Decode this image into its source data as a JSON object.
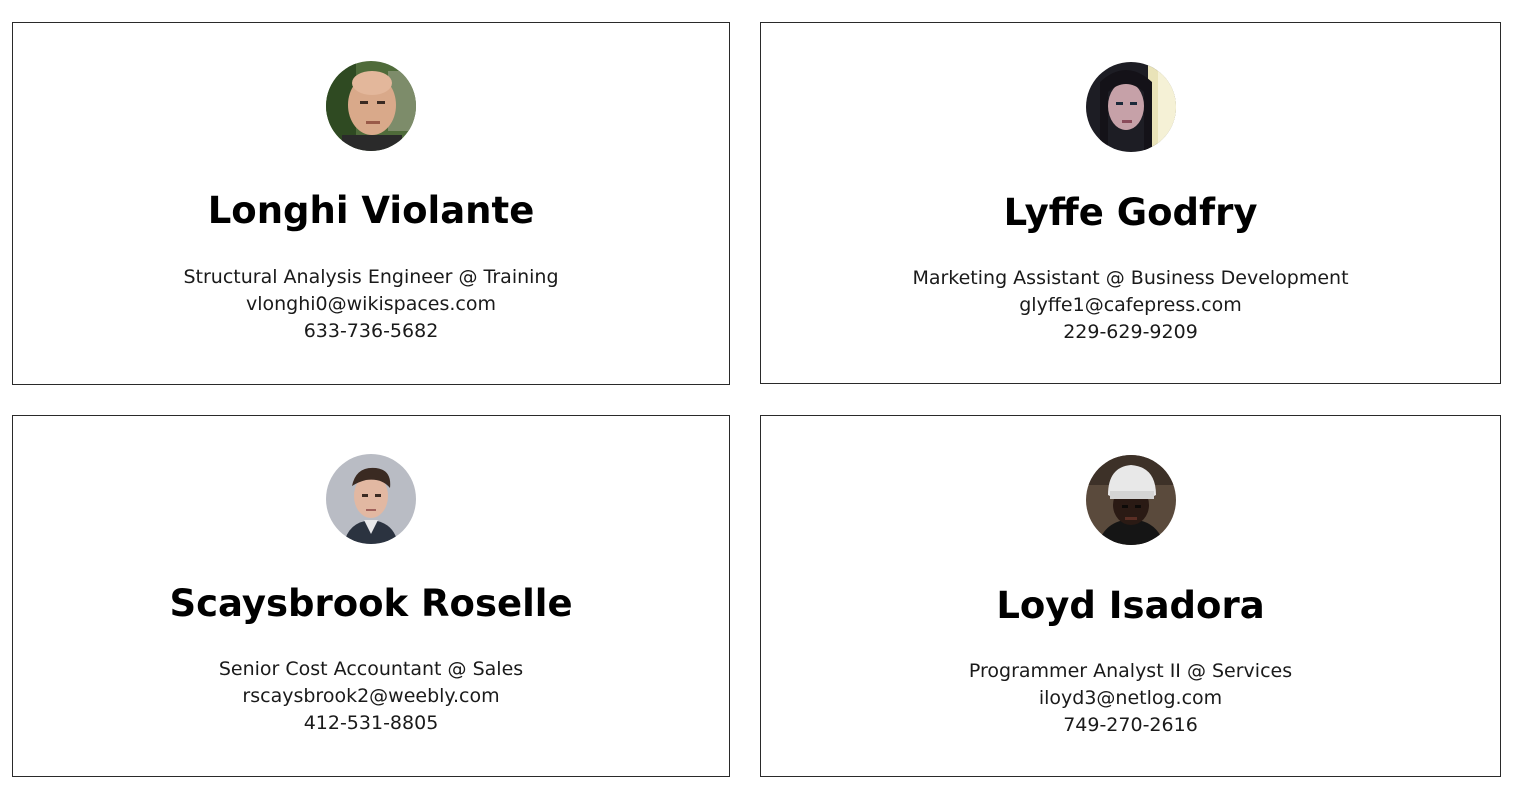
{
  "cards": [
    {
      "name": "Longhi Violante",
      "title": "Structural Analysis Engineer @ Training",
      "email": "vlonghi0@wikispaces.com",
      "phone": "633-736-5682",
      "avatar_icon": "avatar-photo-bald-man"
    },
    {
      "name": "Lyffe Godfry",
      "title": "Marketing Assistant @ Business Development",
      "email": "glyffe1@cafepress.com",
      "phone": "229-629-9209",
      "avatar_icon": "avatar-photo-woman-dark-hair"
    },
    {
      "name": "Scaysbrook Roselle",
      "title": "Senior Cost Accountant @ Sales",
      "email": "rscaysbrook2@weebly.com",
      "phone": "412-531-8805",
      "avatar_icon": "avatar-photo-young-man-suit"
    },
    {
      "name": "Loyd Isadora",
      "title": "Programmer Analyst II @ Services",
      "email": "iloyd3@netlog.com",
      "phone": "749-270-2616",
      "avatar_icon": "avatar-photo-man-white-beanie"
    }
  ]
}
